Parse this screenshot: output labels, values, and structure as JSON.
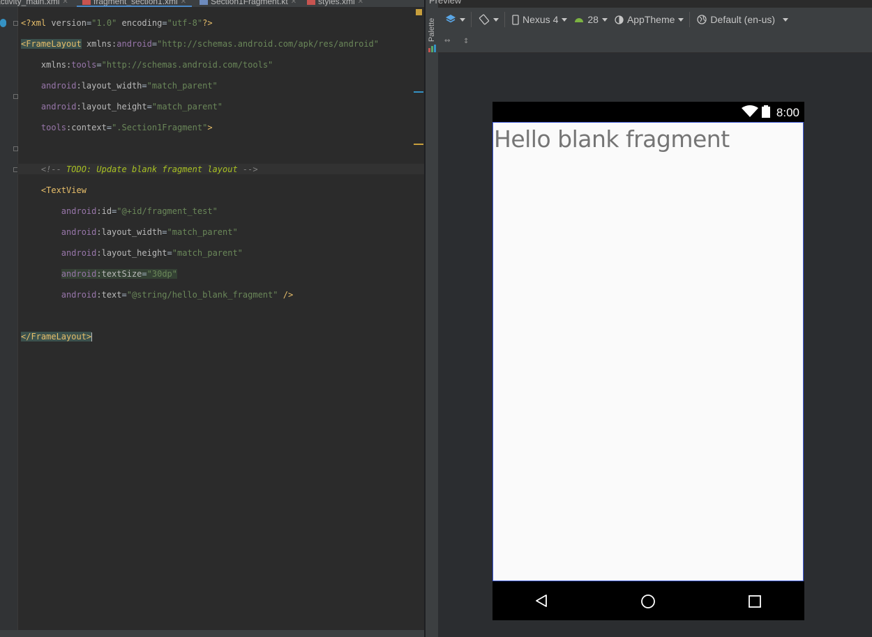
{
  "tabs": [
    {
      "label": "activity_main.xml"
    },
    {
      "label": "fragment_section1.xml"
    },
    {
      "label": "Section1Fragment.kt"
    },
    {
      "label": "styles.xml"
    }
  ],
  "editor": {
    "lines": {
      "l1_decl": "<?xml",
      "l1_version_attr": "version",
      "l1_version_val": "\"1.0\"",
      "l1_enc_attr": "encoding",
      "l1_enc_val": "\"utf-8\"",
      "l1_end": "?>",
      "l2_tag": "<FrameLayout",
      "l2_attr": "xmlns:",
      "l2_ns": "android",
      "l2_val": "\"http://schemas.android.com/apk/res/android\"",
      "l3_attr": "xmlns:",
      "l3_ns": "tools",
      "l3_val": "\"http://schemas.android.com/tools\"",
      "l4_ns": "android",
      "l4_attr": ":layout_width",
      "l4_val": "\"match_parent\"",
      "l5_ns": "android",
      "l5_attr": ":layout_height",
      "l5_val": "\"match_parent\"",
      "l6_ns": "tools",
      "l6_attr": ":context",
      "l6_val": "\".Section1Fragment\"",
      "l6_end": ">",
      "l8_open": "<!--",
      "l8_todo": "TODO: Update blank fragment layout",
      "l8_close": "-->",
      "l9_tag": "<TextView",
      "l10_ns": "android",
      "l10_attr": ":id",
      "l10_val": "\"@+id/fragment_test\"",
      "l11_ns": "android",
      "l11_attr": ":layout_width",
      "l11_val": "\"match_parent\"",
      "l12_ns": "android",
      "l12_attr": ":layout_height",
      "l12_val": "\"match_parent\"",
      "l13_ns": "android",
      "l13_attr": ":textSize",
      "l13_val": "\"30dp\"",
      "l14_ns": "android",
      "l14_attr": ":text",
      "l14_val": "\"@string/hello_blank_fragment\"",
      "l14_end": "/>",
      "l16_tag": "</FrameLayout>"
    }
  },
  "sidebar": {
    "palette_label": "Palette"
  },
  "preview": {
    "title": "Preview",
    "toolbar": {
      "device": "Nexus 4",
      "api": "28",
      "theme": "AppTheme",
      "locale": "Default (en-us)"
    },
    "device": {
      "time": "8:00",
      "text": "Hello blank fragment"
    }
  },
  "colors": {
    "accent": "#4a88c7",
    "tag": "#e8bf6a",
    "value": "#6a8759",
    "namespace": "#9876aa"
  }
}
